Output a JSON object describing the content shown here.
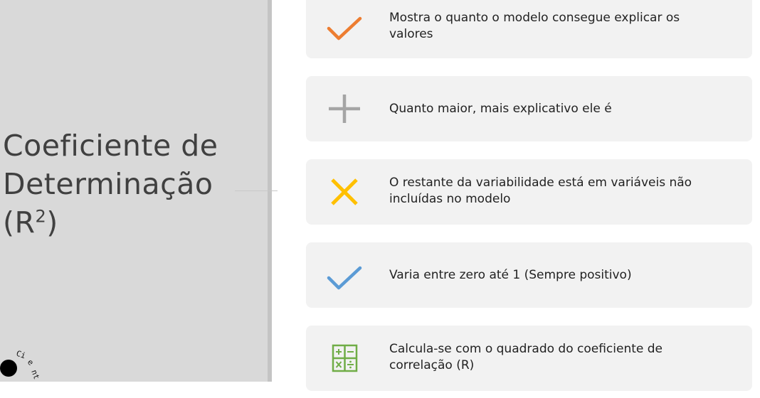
{
  "slide": {
    "title_line1": "Coeficiente de",
    "title_line2": "Determinação",
    "title_line3_base": "(R",
    "title_line3_sup": "2",
    "title_line3_end": ")"
  },
  "logo": {
    "text_fragment": "o Cient"
  },
  "items": [
    {
      "icon": "check-orange-icon",
      "color": "#ED7D31",
      "text": "Mostra o quanto o modelo consegue explicar os valores"
    },
    {
      "icon": "plus-gray-icon",
      "color": "#A5A5A5",
      "text": "Quanto maior, mais explicativo ele é"
    },
    {
      "icon": "close-yellow-icon",
      "color": "#FFC000",
      "text": "O restante da variabilidade está em variáveis não incluídas no modelo"
    },
    {
      "icon": "check-blue-icon",
      "color": "#5B9BD5",
      "text": "Varia entre zero até 1 (Sempre positivo)"
    },
    {
      "icon": "calculator-green-icon",
      "color": "#70AD47",
      "text": "Calcula-se com o quadrado do coeficiente de correlação (R)"
    }
  ]
}
